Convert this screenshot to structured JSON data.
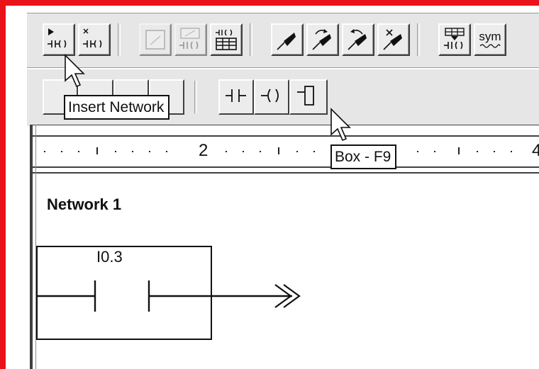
{
  "toolbar_top": {
    "icons": [
      "insert-network-icon",
      "delete-network-icon",
      "blank-page-icon",
      "network-comment-icon",
      "network-table-icon",
      "pen-edit-icon",
      "pen-redo-icon",
      "pen-undo-icon",
      "pen-delete-icon",
      "download-icon",
      "symbol-icon"
    ],
    "symbol_button_label": "sym"
  },
  "toolbar_ladder": {
    "icons": [
      "contact-icon",
      "coil-icon",
      "box-icon"
    ]
  },
  "ruler": {
    "label_2": "2",
    "label_4": "4"
  },
  "tooltips": {
    "insert_network": "Insert Network",
    "box": "Box - F9"
  },
  "editor": {
    "network_title": "Network 1",
    "contact_address": "I0.3"
  },
  "colors": {
    "frame_red": "#e8141a",
    "toolbar_bg": "#e6e6e6"
  }
}
